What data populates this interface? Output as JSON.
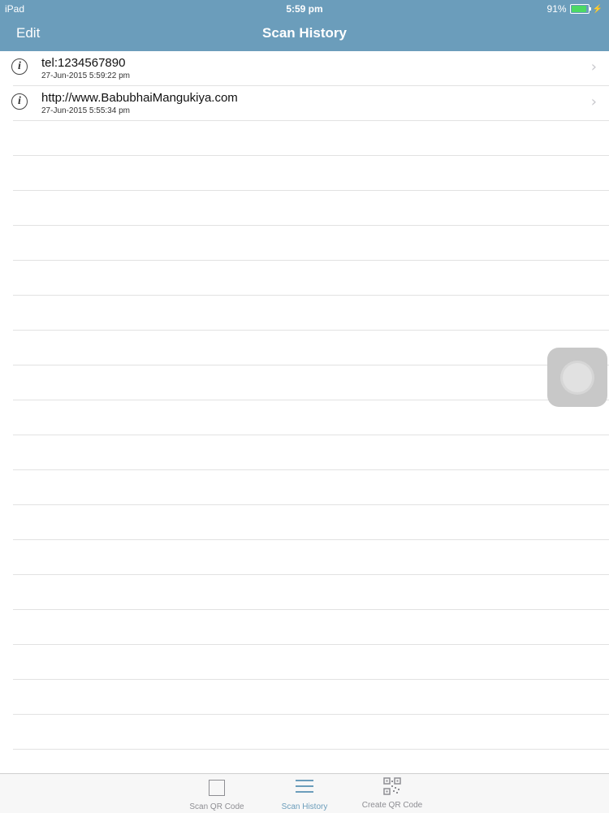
{
  "status_bar": {
    "device": "iPad",
    "time": "5:59 pm",
    "battery": "91%",
    "battery_level": 0.91,
    "battery_color": "#4cd964"
  },
  "nav": {
    "edit_label": "Edit",
    "title": "Scan History",
    "background": "#6b9dbb"
  },
  "history": [
    {
      "value": "tel:1234567890",
      "timestamp": "27-Jun-2015 5:59:22 pm",
      "icon": "info-icon"
    },
    {
      "value": "http://www.BabubhaiMangukiya.com",
      "timestamp": "27-Jun-2015 5:55:34 pm",
      "icon": "info-icon"
    }
  ],
  "tabs": [
    {
      "label": "Scan QR Code",
      "icon": "scan-square-icon",
      "selected": false
    },
    {
      "label": "Scan History",
      "icon": "list-lines-icon",
      "selected": true
    },
    {
      "label": "Create QR Code",
      "icon": "qr-code-icon",
      "selected": false
    }
  ],
  "colors": {
    "accent": "#6b9dbb",
    "tab_inactive": "#8e8e93"
  }
}
